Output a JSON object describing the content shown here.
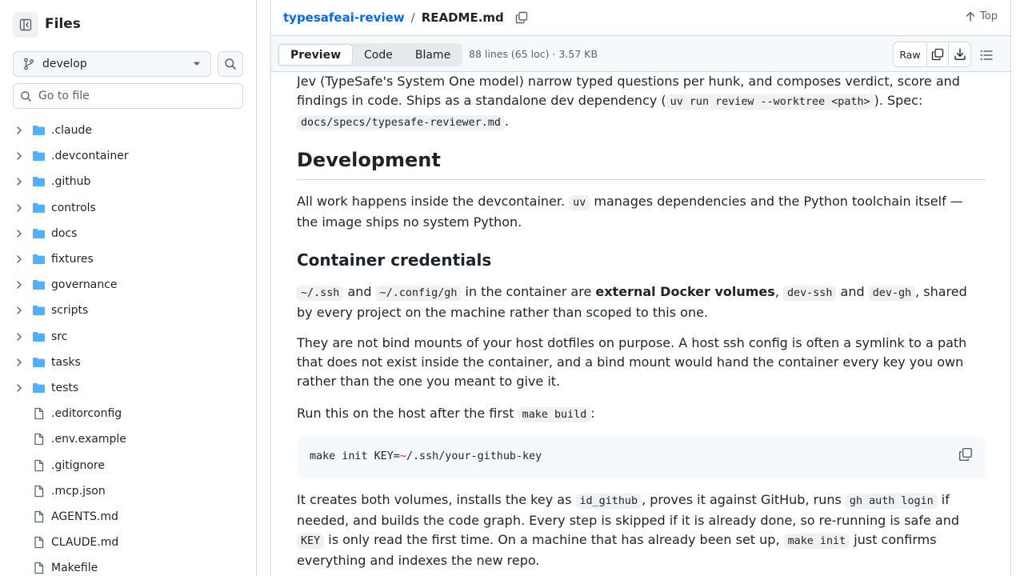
{
  "sidebar": {
    "title": "Files",
    "branch": "develop",
    "goto_placeholder": "Go to file",
    "tree": [
      {
        "name": ".claude",
        "type": "folder"
      },
      {
        "name": ".devcontainer",
        "type": "folder"
      },
      {
        "name": ".github",
        "type": "folder"
      },
      {
        "name": "controls",
        "type": "folder"
      },
      {
        "name": "docs",
        "type": "folder"
      },
      {
        "name": "fixtures",
        "type": "folder"
      },
      {
        "name": "governance",
        "type": "folder"
      },
      {
        "name": "scripts",
        "type": "folder"
      },
      {
        "name": "src",
        "type": "folder"
      },
      {
        "name": "tasks",
        "type": "folder"
      },
      {
        "name": "tests",
        "type": "folder"
      },
      {
        "name": ".editorconfig",
        "type": "file"
      },
      {
        "name": ".env.example",
        "type": "file"
      },
      {
        "name": ".gitignore",
        "type": "file"
      },
      {
        "name": ".mcp.json",
        "type": "file"
      },
      {
        "name": "AGENTS.md",
        "type": "file"
      },
      {
        "name": "CLAUDE.md",
        "type": "file"
      },
      {
        "name": "Makefile",
        "type": "file"
      }
    ]
  },
  "header": {
    "repo": "typesafeai-review",
    "separator": "/",
    "file": "README.md",
    "top_label": "Top"
  },
  "filebar": {
    "tabs": [
      "Preview",
      "Code",
      "Blame"
    ],
    "active_tab": "Preview",
    "stats": "88 lines (65 loc) · 3.57 KB",
    "raw_label": "Raw"
  },
  "article": {
    "p_intro": {
      "t1": "Jev (TypeSafe's System One model) narrow typed questions per hunk, and composes verdict, score and findings in code. Ships as a standalone dev dependency (",
      "c1": "uv run review --worktree <path>",
      "t2": "). Spec: ",
      "c2": "docs/specs/typesafe-reviewer.md",
      "t3": "."
    },
    "h_development": "Development",
    "p_dev": {
      "t1": "All work happens inside the devcontainer. ",
      "c1": "uv",
      "t2": " manages dependencies and the Python toolchain itself — the image ships no system Python."
    },
    "h_credentials": "Container credentials",
    "p_cred1": {
      "c1": "~/.ssh",
      "t1": " and ",
      "c2": "~/.config/gh",
      "t2": " in the container are ",
      "b1": "external Docker volumes",
      "t3": ", ",
      "c3": "dev-ssh",
      "t4": " and ",
      "c4": "dev-gh",
      "t5": ", shared by every project on the machine rather than scoped to this one."
    },
    "p_cred2": "They are not bind mounts of your host dotfiles on purpose. A host ssh config is often a symlink to a path that does not exist inside the container, and a bind mount would hand the container every key you own rather than the one you meant to give it.",
    "p_run": {
      "t1": "Run this on the host after the first ",
      "c1": "make build",
      "t2": ":"
    },
    "code": {
      "pre": "make init KEY=",
      "tilde": "~",
      "post": "/.ssh/your-github-key"
    },
    "p_after": {
      "t1": "It creates both volumes, installs the key as ",
      "c1": "id_github",
      "t2": ", proves it against GitHub, runs ",
      "c2": "gh auth login",
      "t3": " if needed, and builds the code graph. Every step is skipped if it is already done, so re-running is safe and ",
      "c3": "KEY",
      "t4": " is only read the first time. On a machine that has already been set up, ",
      "c4": "make init",
      "t5": " just confirms everything and indexes the new repo."
    }
  }
}
